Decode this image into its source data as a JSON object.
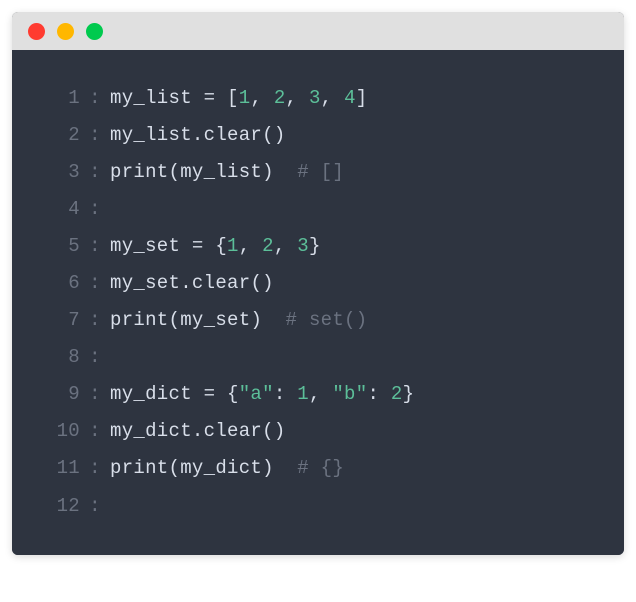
{
  "traffic_lights": [
    "red",
    "yellow",
    "green"
  ],
  "code_lines": [
    {
      "n": 1,
      "tokens": [
        {
          "t": "my_list",
          "c": "t-var"
        },
        {
          "t": " = ",
          "c": "t-op"
        },
        {
          "t": "[",
          "c": "t-punc"
        },
        {
          "t": "1",
          "c": "t-num"
        },
        {
          "t": ", ",
          "c": "t-punc"
        },
        {
          "t": "2",
          "c": "t-num"
        },
        {
          "t": ", ",
          "c": "t-punc"
        },
        {
          "t": "3",
          "c": "t-num"
        },
        {
          "t": ", ",
          "c": "t-punc"
        },
        {
          "t": "4",
          "c": "t-num"
        },
        {
          "t": "]",
          "c": "t-punc"
        }
      ]
    },
    {
      "n": 2,
      "tokens": [
        {
          "t": "my_list",
          "c": "t-var"
        },
        {
          "t": ".",
          "c": "t-punc"
        },
        {
          "t": "clear",
          "c": "t-method"
        },
        {
          "t": "()",
          "c": "t-punc"
        }
      ]
    },
    {
      "n": 3,
      "tokens": [
        {
          "t": "print",
          "c": "t-builtin"
        },
        {
          "t": "(",
          "c": "t-punc"
        },
        {
          "t": "my_list",
          "c": "t-var"
        },
        {
          "t": ")",
          "c": "t-punc"
        },
        {
          "t": "  ",
          "c": "t-punc"
        },
        {
          "t": "# []",
          "c": "t-comment"
        }
      ]
    },
    {
      "n": 4,
      "tokens": []
    },
    {
      "n": 5,
      "tokens": [
        {
          "t": "my_set",
          "c": "t-var"
        },
        {
          "t": " = ",
          "c": "t-op"
        },
        {
          "t": "{",
          "c": "t-punc"
        },
        {
          "t": "1",
          "c": "t-num"
        },
        {
          "t": ", ",
          "c": "t-punc"
        },
        {
          "t": "2",
          "c": "t-num"
        },
        {
          "t": ", ",
          "c": "t-punc"
        },
        {
          "t": "3",
          "c": "t-num"
        },
        {
          "t": "}",
          "c": "t-punc"
        }
      ]
    },
    {
      "n": 6,
      "tokens": [
        {
          "t": "my_set",
          "c": "t-var"
        },
        {
          "t": ".",
          "c": "t-punc"
        },
        {
          "t": "clear",
          "c": "t-method"
        },
        {
          "t": "()",
          "c": "t-punc"
        }
      ]
    },
    {
      "n": 7,
      "tokens": [
        {
          "t": "print",
          "c": "t-builtin"
        },
        {
          "t": "(",
          "c": "t-punc"
        },
        {
          "t": "my_set",
          "c": "t-var"
        },
        {
          "t": ")",
          "c": "t-punc"
        },
        {
          "t": "  ",
          "c": "t-punc"
        },
        {
          "t": "# set()",
          "c": "t-comment"
        }
      ]
    },
    {
      "n": 8,
      "tokens": []
    },
    {
      "n": 9,
      "tokens": [
        {
          "t": "my_dict",
          "c": "t-var"
        },
        {
          "t": " = ",
          "c": "t-op"
        },
        {
          "t": "{",
          "c": "t-punc"
        },
        {
          "t": "\"a\"",
          "c": "t-str"
        },
        {
          "t": ": ",
          "c": "t-punc"
        },
        {
          "t": "1",
          "c": "t-num"
        },
        {
          "t": ", ",
          "c": "t-punc"
        },
        {
          "t": "\"b\"",
          "c": "t-str"
        },
        {
          "t": ": ",
          "c": "t-punc"
        },
        {
          "t": "2",
          "c": "t-num"
        },
        {
          "t": "}",
          "c": "t-punc"
        }
      ]
    },
    {
      "n": 10,
      "tokens": [
        {
          "t": "my_dict",
          "c": "t-var"
        },
        {
          "t": ".",
          "c": "t-punc"
        },
        {
          "t": "clear",
          "c": "t-method"
        },
        {
          "t": "()",
          "c": "t-punc"
        }
      ]
    },
    {
      "n": 11,
      "tokens": [
        {
          "t": "print",
          "c": "t-builtin"
        },
        {
          "t": "(",
          "c": "t-punc"
        },
        {
          "t": "my_dict",
          "c": "t-var"
        },
        {
          "t": ")",
          "c": "t-punc"
        },
        {
          "t": "  ",
          "c": "t-punc"
        },
        {
          "t": "# {}",
          "c": "t-comment"
        }
      ]
    },
    {
      "n": 12,
      "tokens": []
    }
  ]
}
